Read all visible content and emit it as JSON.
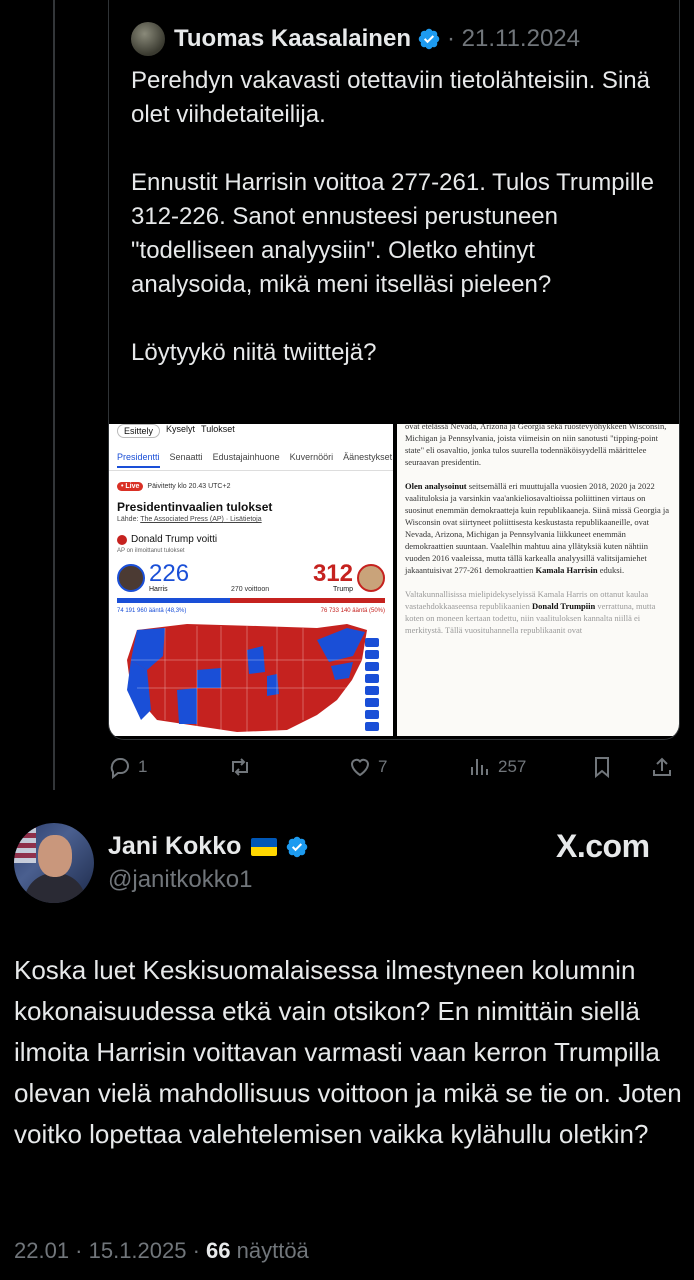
{
  "quoted": {
    "author_name": "Tuomas Kaasalainen",
    "date": "· 21.11.2024",
    "text": "Perehdyn vakavasti otettaviin tietolähteisiin. Sinä olet viihdetaiteilija.\n\nEnnustit Harrisin voittoa 277-261. Tulos Trumpille 312-226. Sanot ennusteesi perustuneen \"todelliseen analyysiin\". Oletko ehtinyt analysoida, mikä meni itselläsi pieleen?\n\nLöytyykö niitä twiittejä?",
    "media_left": {
      "chips": [
        "Esittely",
        "Kyselyt",
        "Tulokset"
      ],
      "tabs": [
        "Presidentti",
        "Senaatti",
        "Edustajainhuone",
        "Kuvernööri",
        "Äänestykset"
      ],
      "live": "• Live",
      "updated": "Päivitetty klo 20.43 UTC+2",
      "title": "Presidentinvaalien tulokset",
      "source_prefix": "Lähde: ",
      "source": "The Associated Press (AP)",
      "source_more": " · Lisätietoja",
      "winner": "Donald Trump voitti",
      "ap_note": "AP on ilmoittanut tulokset",
      "harris_ev": "226",
      "harris_name": "Harris",
      "trump_ev": "312",
      "trump_name": "Trump",
      "to_win": "270 voittoon",
      "harris_votes": "74 191 960 ääntä (48,3%)",
      "trump_votes": "76 733 140 ääntä (50%)",
      "harris_share": 42,
      "trump_share": 58
    },
    "media_right": {
      "p1": "ovat etelässä Nevada, Arizona ja Georgia sekä ruostevyöhykkeen Wisconsin, Michigan ja Pennsylvania, joista viimeisin on niin sanotusti \"tipping-point state\" eli osavaltio, jonka tulos suurella todennäköisyydellä määrittelee seuraavan presidentin.",
      "p2_bold": "Olen analysoinut",
      "p2": " seitsemällä eri muuttujalla vuosien 2018, 2020 ja 2022 vaalituloksia ja varsinkin vaa'ankieliosavaltioissa poliittinen virtaus on suosinut enemmän demokraatteja kuin republikaaneja. Siinä missä Georgia ja Wisconsin ovat siirtyneet poliittisesta keskustasta republikaaneille, ovat Nevada, Arizona, Michigan ja Pennsylvania liikkuneet enemmän demokraattien suuntaan. Vaalelhin mahtuu aina yllätyksiä kuten nähtiin vuoden 2016 vaaleissa, mutta tällä karkealla analyysillä valitsijamiehet jakaantuisivat 277-261 demokraattien ",
      "p2_bold2": "Kamala Harrisin",
      "p2_end": " eduksi.",
      "p3": "Valtakunnallisissa mielipidekyselyissä Kamala Harris on ottanut kaulaa vastaehdokkaaseensa republikaanien ",
      "p3_bold": "Donald Trumpiin",
      "p3_end": " verrattuna, mutta koten on moneen kertaan todettu, niin vaalituloksen kannalta niillä ei merkitystä. Tällä vuosituhannella republikaanit ovat"
    },
    "actions": {
      "replies": "1",
      "likes": "7",
      "views": "257"
    }
  },
  "tweet": {
    "author_name": "Jani Kokko",
    "handle": "@janitkokko1",
    "brand": "X.com",
    "text": "Koska luet Keskisuomalaisessa ilmestyneen kolumnin kokonaisuudessa etkä vain otsikon? En nimittäin siellä ilmoita Harrisin voittavan varmasti vaan kerron Trumpilla olevan vielä mahdollisuus voittoon ja mikä se tie on. Joten voitko lopettaa valehtelemisen vaikka kylähullu oletkin?",
    "time": "22.01 · 15.1.2025 · ",
    "views_count": "66",
    "views_label": " näyttöä"
  },
  "colors": {
    "verified": "#1d9bf0",
    "dem": "#1a4fd7",
    "rep": "#c5221f"
  }
}
